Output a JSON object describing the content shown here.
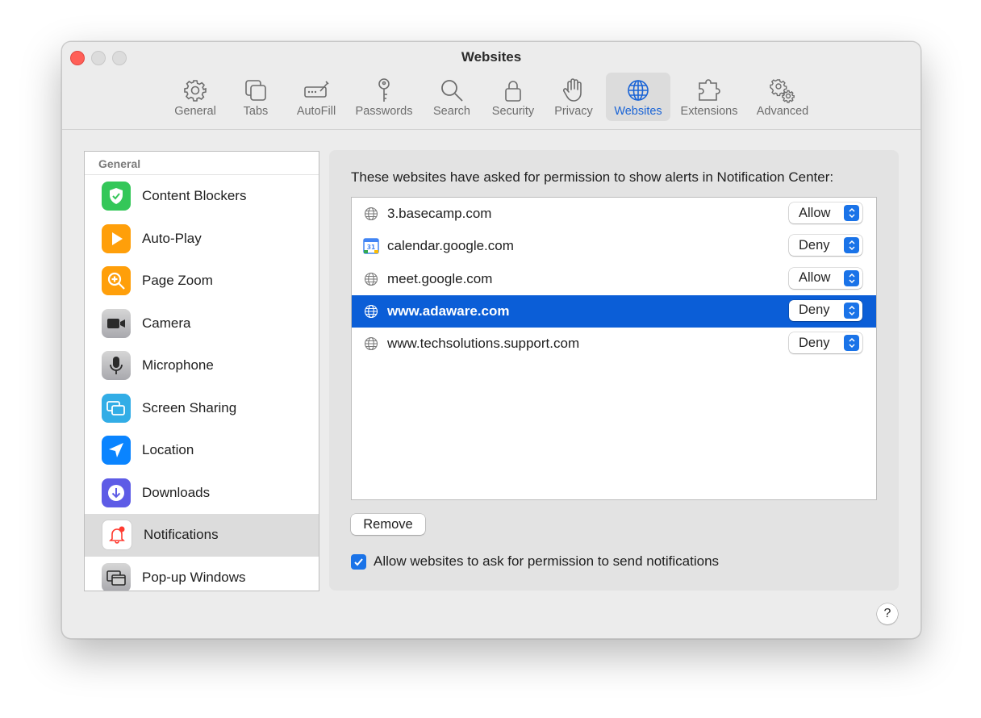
{
  "window": {
    "title": "Websites"
  },
  "toolbar": {
    "items": [
      {
        "label": "General",
        "icon": "gear-icon"
      },
      {
        "label": "Tabs",
        "icon": "tabs-icon"
      },
      {
        "label": "AutoFill",
        "icon": "autofill-icon"
      },
      {
        "label": "Passwords",
        "icon": "key-icon"
      },
      {
        "label": "Search",
        "icon": "search-icon"
      },
      {
        "label": "Security",
        "icon": "lock-icon"
      },
      {
        "label": "Privacy",
        "icon": "hand-icon"
      },
      {
        "label": "Websites",
        "icon": "globe-icon",
        "active": true
      },
      {
        "label": "Extensions",
        "icon": "puzzle-icon"
      },
      {
        "label": "Advanced",
        "icon": "gears-icon"
      }
    ]
  },
  "sidebar": {
    "header": "General",
    "items": [
      {
        "label": "Content Blockers",
        "icon": "shield-check-icon",
        "color": "#34c759"
      },
      {
        "label": "Auto-Play",
        "icon": "play-icon",
        "color": "#ff9f0a"
      },
      {
        "label": "Page Zoom",
        "icon": "zoom-icon",
        "color": "#ff9f0a"
      },
      {
        "label": "Camera",
        "icon": "camera-icon",
        "color": "#8e8e93"
      },
      {
        "label": "Microphone",
        "icon": "microphone-icon",
        "color": "#8e8e93"
      },
      {
        "label": "Screen Sharing",
        "icon": "screen-sharing-icon",
        "color": "#32ade6"
      },
      {
        "label": "Location",
        "icon": "location-icon",
        "color": "#0a84ff"
      },
      {
        "label": "Downloads",
        "icon": "download-icon",
        "color": "#5e5ce6"
      },
      {
        "label": "Notifications",
        "icon": "bell-icon",
        "color": "#ff3b30",
        "selected": true
      },
      {
        "label": "Pop-up Windows",
        "icon": "popup-windows-icon",
        "color": "#8e8e93"
      }
    ]
  },
  "panel": {
    "description": "These websites have asked for permission to show alerts in Notification Center:",
    "sites": [
      {
        "domain": "3.basecamp.com",
        "permission": "Allow",
        "icon": "globe-icon"
      },
      {
        "domain": "calendar.google.com",
        "permission": "Deny",
        "icon": "calendar-icon"
      },
      {
        "domain": "meet.google.com",
        "permission": "Allow",
        "icon": "globe-icon"
      },
      {
        "domain": "www.adaware.com",
        "permission": "Deny",
        "icon": "globe-icon",
        "selected": true
      },
      {
        "domain": "www.techsolutions.support.com",
        "permission": "Deny",
        "icon": "globe-icon"
      }
    ],
    "remove_label": "Remove",
    "allow_checkbox_label": "Allow websites to ask for permission to send notifications",
    "allow_checked": true,
    "calendar_day": "31"
  },
  "help_label": "?",
  "colors": {
    "accent": "#0b5ed7",
    "close": "#ff5f57"
  }
}
